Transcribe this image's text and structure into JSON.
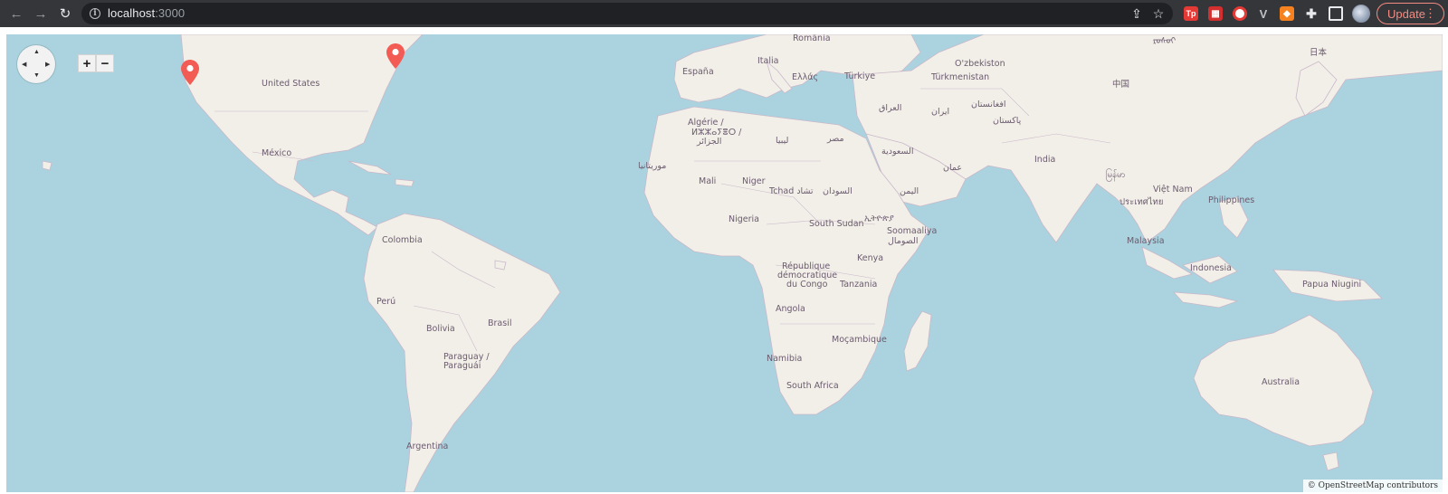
{
  "browser": {
    "url_host": "localhost",
    "url_port": ":3000",
    "update_label": "Update",
    "icons": [
      "back-arrow-icon",
      "forward-arrow-icon",
      "reload-icon",
      "info-icon",
      "share-icon",
      "star-icon",
      "puzzle-icon",
      "sidepanel-icon",
      "kebab-menu-icon"
    ],
    "extension_badge_text": "Tp"
  },
  "map": {
    "controls": {
      "zoom_in": "+",
      "zoom_out": "−"
    },
    "attribution": "© OpenStreetMap contributors",
    "labels": {
      "romania": "România",
      "russia_partial": "ᠷᠣᠰᠣᠶ",
      "japan": "日本",
      "espana": "España",
      "italia": "Italia",
      "ozbekiston": "O'zbekiston",
      "ellas": "Ελλάς",
      "turkiye": "Türkiye",
      "turkmenistan": "Türkmenistan",
      "china": "中国",
      "united_states": "United States",
      "iraq": "العراق",
      "iran": "ایران",
      "afghanistan": "افغانستان",
      "pakistan": "پاکستان",
      "algeria_line1": "Algérie /",
      "algeria_line2": "ⵍⵣⵣⴰⵢⴻⵔ /",
      "algeria_line3": "الجزائر",
      "libya": "ليبيا",
      "egypt": "مصر",
      "saudi": "السعودية",
      "mexico": "México",
      "mauritania": "موريتانيا",
      "oman": "عمان",
      "india": "India",
      "myanmar": "မြန်မာ",
      "mali": "Mali",
      "niger": "Niger",
      "tchad": "Tchad تشاد",
      "sudan": "السودان",
      "yemen": "اليمن",
      "vietnam": "Việt Nam",
      "philippines": "Philippines",
      "thailand": "ประเทศไทย",
      "nigeria": "Nigeria",
      "south_sudan": "South Sudan",
      "ethiopia": "ኢትዮጵያ",
      "somalia_line1": "Soomaaliya",
      "somalia_line2": "الصومال",
      "colombia": "Colombia",
      "malaysia": "Malaysia",
      "kenya": "Kenya",
      "indonesia": "Indonesia",
      "drc_line1": "République",
      "drc_line2": "démocratique",
      "drc_line3": "du Congo",
      "tanzania": "Tanzania",
      "papua": "Papua Niugini",
      "peru": "Perú",
      "brasil": "Brasil",
      "bolivia": "Bolivia",
      "angola": "Angola",
      "mocambique": "Moçambique",
      "paraguay_line1": "Paraguay /",
      "paraguay_line2": "Paraguái",
      "namibia": "Namibia",
      "australia": "Australia",
      "south_africa": "South Africa",
      "argentina": "Argentina"
    },
    "markers": [
      "map-pin-west-coast",
      "map-pin-east-coast"
    ],
    "colors": {
      "water": "#aad3df",
      "land": "#f2efe9",
      "border": "#b9a8b9",
      "marker": "#f25c54"
    }
  }
}
